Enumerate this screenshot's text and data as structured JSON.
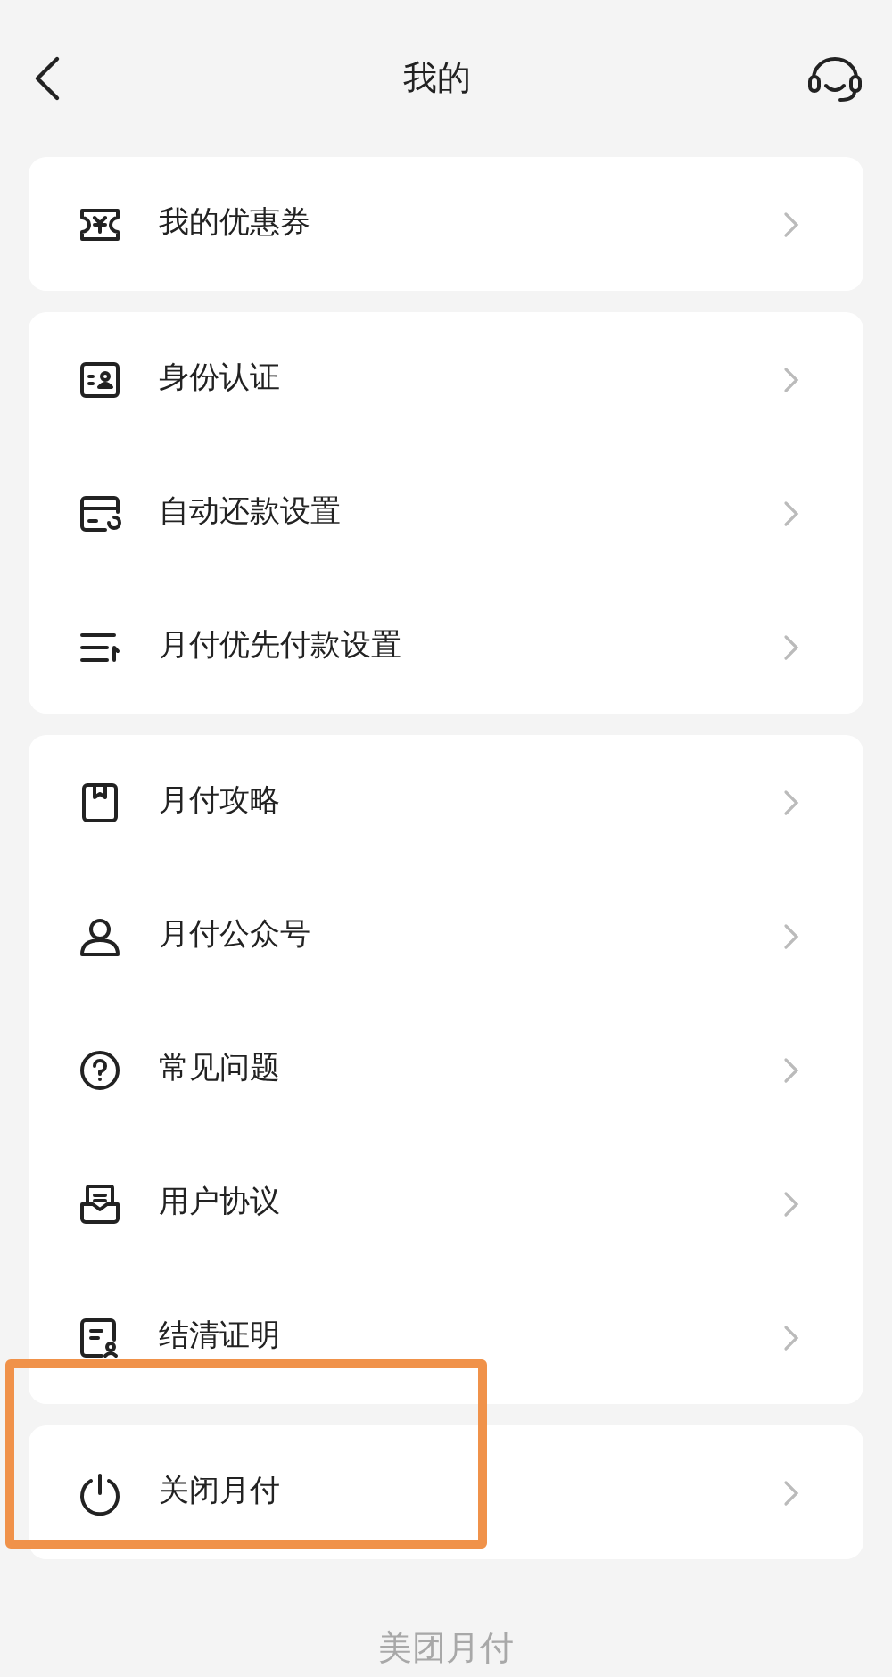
{
  "header": {
    "title": "我的"
  },
  "groups": [
    {
      "items": [
        {
          "kind": "ticket",
          "label": "我的优惠券",
          "highlighted": false
        }
      ]
    },
    {
      "items": [
        {
          "kind": "id-card",
          "label": "身份认证",
          "highlighted": false
        },
        {
          "kind": "card-auto",
          "label": "自动还款设置",
          "highlighted": false
        },
        {
          "kind": "list-priority",
          "label": "月付优先付款设置",
          "highlighted": false
        }
      ]
    },
    {
      "items": [
        {
          "kind": "book",
          "label": "月付攻略",
          "highlighted": false
        },
        {
          "kind": "person",
          "label": "月付公众号",
          "highlighted": false
        },
        {
          "kind": "question",
          "label": "常见问题",
          "highlighted": false
        },
        {
          "kind": "agreement",
          "label": "用户协议",
          "highlighted": false
        },
        {
          "kind": "certificate",
          "label": "结清证明",
          "highlighted": false
        }
      ]
    },
    {
      "items": [
        {
          "kind": "power",
          "label": "关闭月付",
          "highlighted": true
        }
      ]
    }
  ],
  "footer": {
    "brand": "美团月付"
  }
}
